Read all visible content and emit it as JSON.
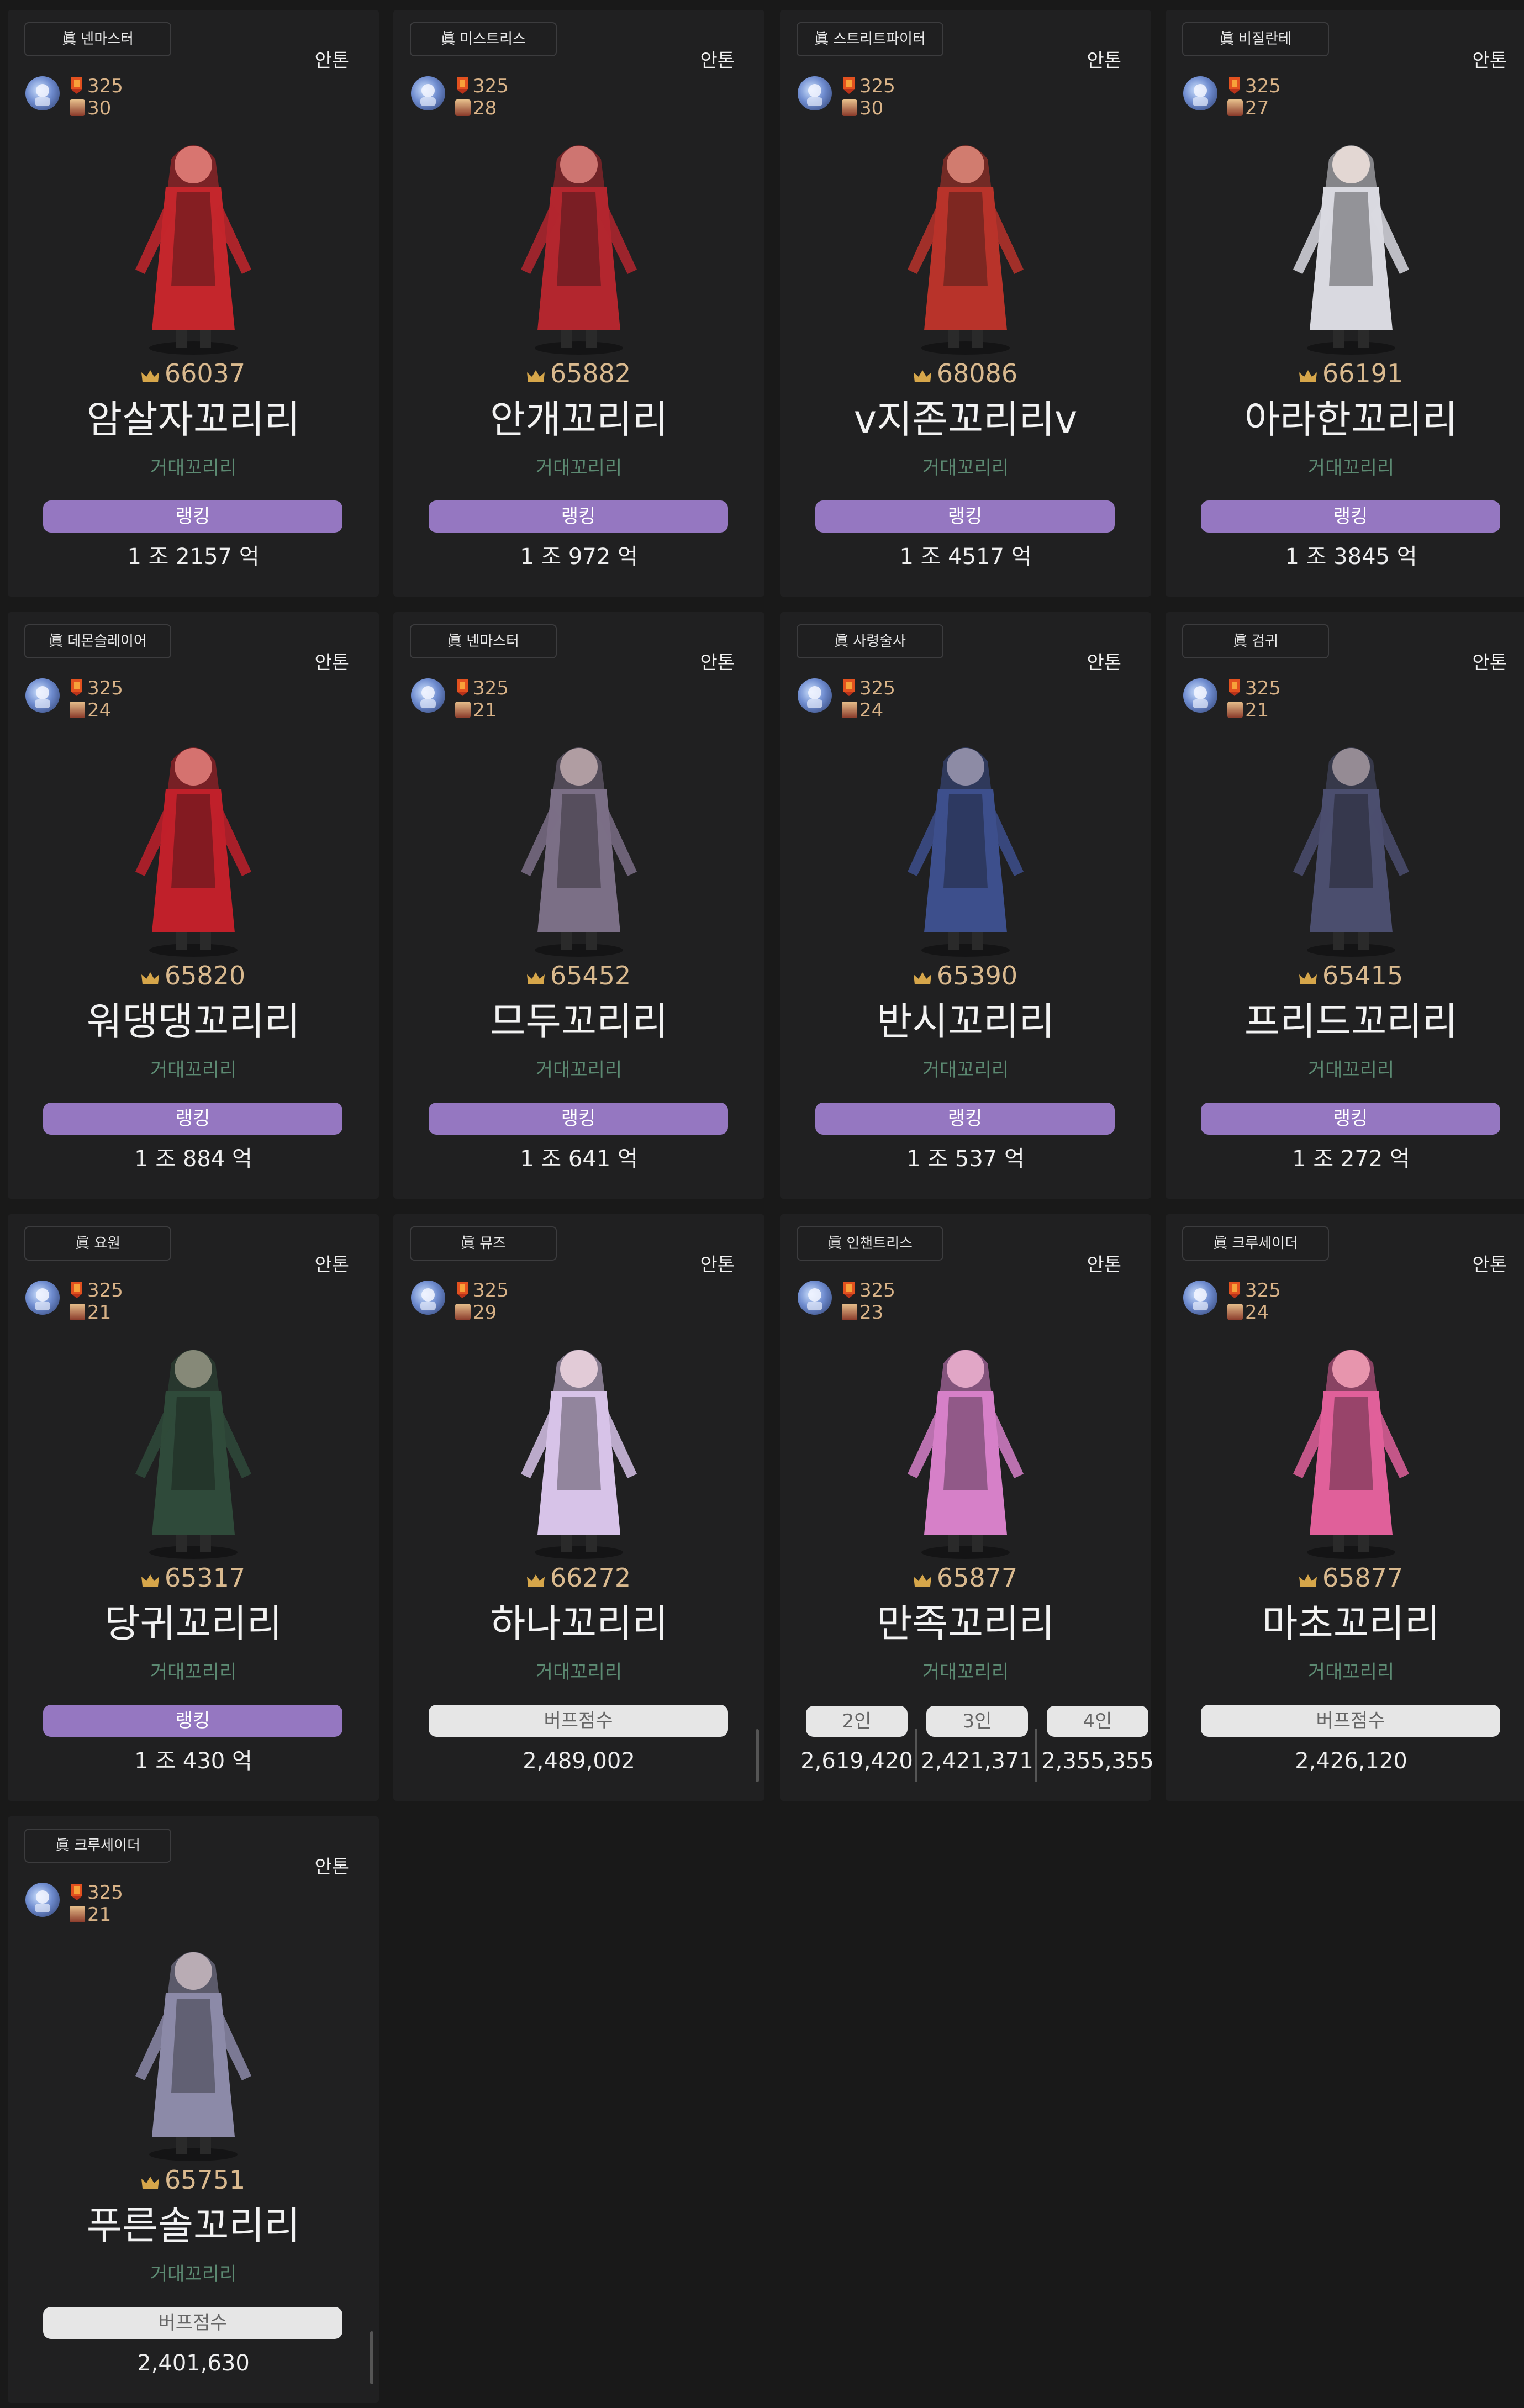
{
  "cards": [
    {
      "job": "眞 넨마스터",
      "server": "안톤",
      "fame": "325",
      "level": "30",
      "score": "66037",
      "name": "암살자꼬리리",
      "adventure": "거대꼬리리",
      "button": "랭킹",
      "value": "1 조 2157 억",
      "color": "#c4262c"
    },
    {
      "job": "眞 미스트리스",
      "server": "안톤",
      "fame": "325",
      "level": "28",
      "score": "65882",
      "name": "안개꼬리리",
      "adventure": "거대꼬리리",
      "button": "랭킹",
      "value": "1 조 972 억",
      "color": "#b3262e"
    },
    {
      "job": "眞 스트리트파이터",
      "server": "안톤",
      "fame": "325",
      "level": "30",
      "score": "68086",
      "name": "v지존꼬리리v",
      "adventure": "거대꼬리리",
      "button": "랭킹",
      "value": "1 조 4517 억",
      "color": "#b8332a"
    },
    {
      "job": "眞 비질란테",
      "server": "안톤",
      "fame": "325",
      "level": "27",
      "score": "66191",
      "name": "아라한꼬리리",
      "adventure": "거대꼬리리",
      "button": "랭킹",
      "value": "1 조 3845 억",
      "color": "#d9d9e0"
    },
    {
      "job": "眞 데몬슬레이어",
      "server": "안톤",
      "fame": "325",
      "level": "24",
      "score": "65820",
      "name": "워댕댕꼬리리",
      "adventure": "거대꼬리리",
      "button": "랭킹",
      "value": "1 조 884 억",
      "color": "#c0202a"
    },
    {
      "job": "眞 넨마스터",
      "server": "안톤",
      "fame": "325",
      "level": "21",
      "score": "65452",
      "name": "므두꼬리리",
      "adventure": "거대꼬리리",
      "button": "랭킹",
      "value": "1 조 641 억",
      "color": "#7b6f86"
    },
    {
      "job": "眞 사령술사",
      "server": "안톤",
      "fame": "325",
      "level": "24",
      "score": "65390",
      "name": "반시꼬리리",
      "adventure": "거대꼬리리",
      "button": "랭킹",
      "value": "1 조 537 억",
      "color": "#3d4f8c"
    },
    {
      "job": "眞 검귀",
      "server": "안톤",
      "fame": "325",
      "level": "21",
      "score": "65415",
      "name": "프리드꼬리리",
      "adventure": "거대꼬리리",
      "button": "랭킹",
      "value": "1 조 272 억",
      "color": "#4b4e6e"
    },
    {
      "job": "眞 요원",
      "server": "안톤",
      "fame": "325",
      "level": "21",
      "score": "65317",
      "name": "당귀꼬리리",
      "adventure": "거대꼬리리",
      "button": "랭킹",
      "value": "1 조 430 억",
      "color": "#2f4a3a"
    },
    {
      "job": "眞 뮤즈",
      "server": "안톤",
      "fame": "325",
      "level": "29",
      "score": "66272",
      "name": "하나꼬리리",
      "adventure": "거대꼬리리",
      "button": "버프점수",
      "value": "2,489,002",
      "color": "#d7c3e8"
    },
    {
      "job": "眞 인챈트리스",
      "server": "안톤",
      "fame": "325",
      "level": "23",
      "score": "65877",
      "name": "만족꼬리리",
      "adventure": "거대꼬리리",
      "party": [
        {
          "label": "2인",
          "value": "2,619,420"
        },
        {
          "label": "3인",
          "value": "2,421,371"
        },
        {
          "label": "4인",
          "value": "2,355,355"
        }
      ],
      "color": "#d680c8"
    },
    {
      "job": "眞 크루세이더",
      "server": "안톤",
      "fame": "325",
      "level": "24",
      "score": "65877",
      "name": "마초꼬리리",
      "adventure": "거대꼬리리",
      "button": "버프점수",
      "value": "2,426,120",
      "color": "#e0609a"
    },
    {
      "job": "眞 크루세이더",
      "server": "안톤",
      "fame": "325",
      "level": "21",
      "score": "65751",
      "name": "푸른솔꼬리리",
      "adventure": "거대꼬리리",
      "button": "버프점수",
      "value": "2,401,630",
      "color": "#8c8aa8"
    }
  ]
}
